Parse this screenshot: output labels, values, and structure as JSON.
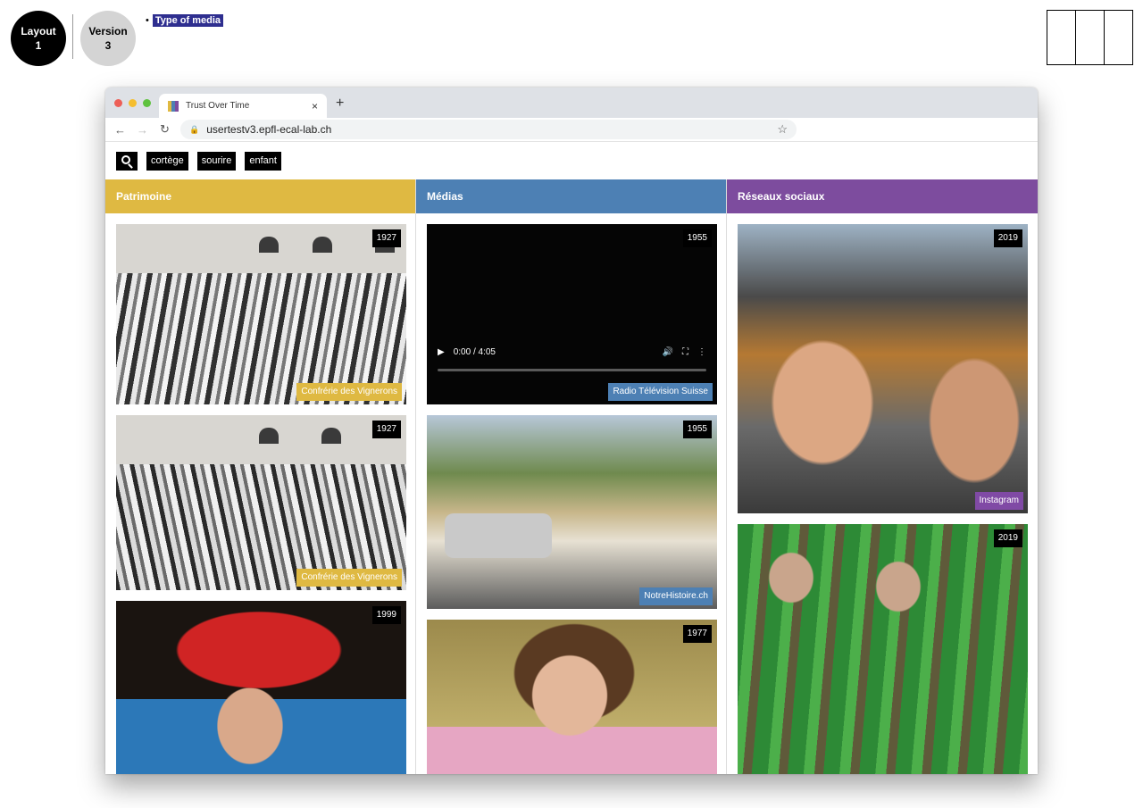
{
  "annotations": {
    "layout_label": "Layout",
    "layout_number": "1",
    "version_label": "Version",
    "version_number": "3",
    "note_bullet": "•",
    "note_text": "Type of media"
  },
  "browser": {
    "tab_title": "Trust Over Time",
    "tab_close": "×",
    "new_tab": "+",
    "url": "usertestv3.epfl-ecal-lab.ch"
  },
  "search": {
    "tags": [
      "cortège",
      "sourire",
      "enfant"
    ]
  },
  "columns": [
    {
      "title": "Patrimoine",
      "color": "#dfb942",
      "cards": [
        {
          "year": "1927",
          "source": "Confrérie des Vignerons"
        },
        {
          "year": "1927",
          "source": "Confrérie des Vignerons"
        },
        {
          "year": "1999",
          "source": ""
        }
      ]
    },
    {
      "title": "Médias",
      "color": "#4d80b4",
      "cards": [
        {
          "year": "1955",
          "source": "Radio Télévision Suisse",
          "video_time": "0:00 / 4:05"
        },
        {
          "year": "1955",
          "source": "NotreHistoire.ch"
        },
        {
          "year": "1977",
          "source": ""
        }
      ]
    },
    {
      "title": "Réseaux sociaux",
      "color": "#7d4c9e",
      "cards": [
        {
          "year": "2019",
          "source": "Instagram"
        },
        {
          "year": "2019",
          "source": ""
        }
      ]
    }
  ]
}
